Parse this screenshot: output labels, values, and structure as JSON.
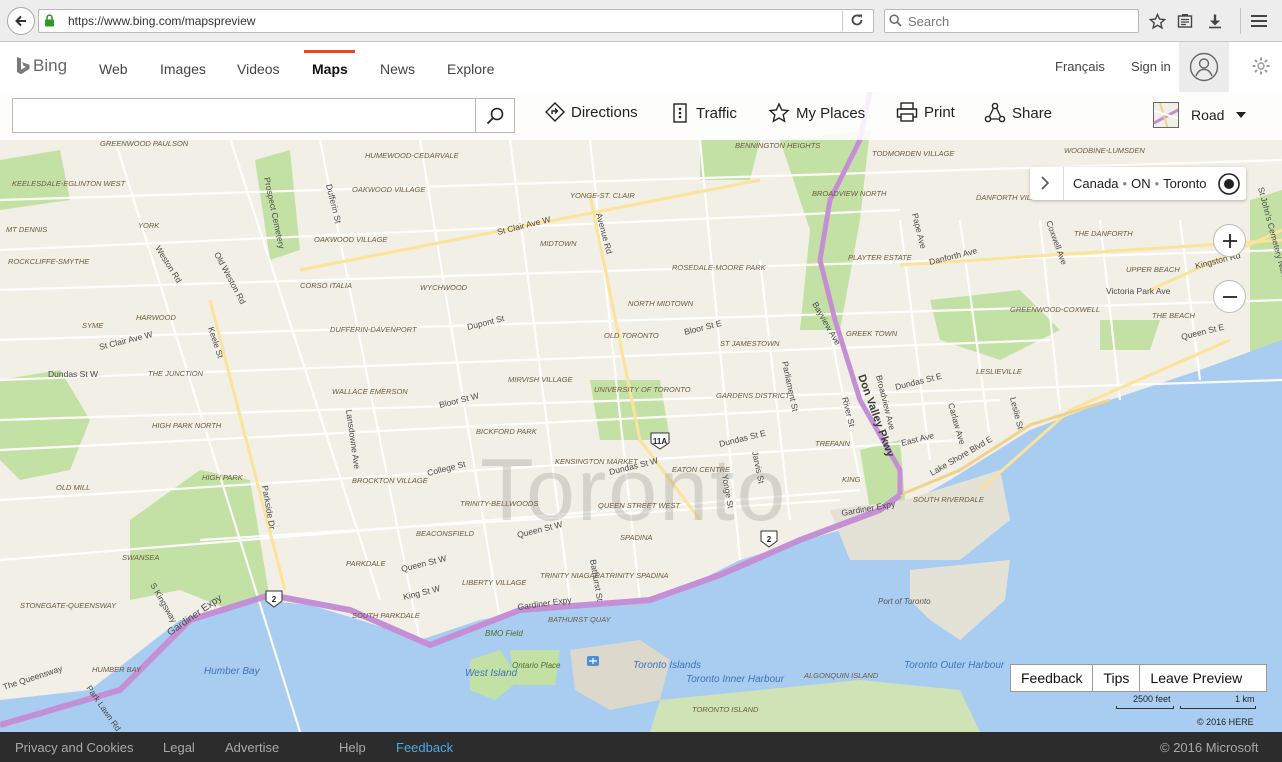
{
  "browser": {
    "url": "https://www.bing.com/mapspreview",
    "search_placeholder": "Search"
  },
  "header": {
    "brand": "Bing",
    "nav": [
      {
        "label": "Web"
      },
      {
        "label": "Images"
      },
      {
        "label": "Videos"
      },
      {
        "label": "Maps",
        "active": true
      },
      {
        "label": "News"
      },
      {
        "label": "Explore"
      }
    ],
    "language": "Français",
    "signin": "Sign in"
  },
  "toolbar": {
    "search_value": "",
    "directions": "Directions",
    "traffic": "Traffic",
    "my_places": "My Places",
    "print": "Print",
    "share": "Share",
    "map_style": "Road"
  },
  "location_bar": {
    "country": "Canada",
    "region": "ON",
    "city": "Toronto"
  },
  "map": {
    "city_watermark": "Toronto",
    "colors": {
      "land": "#f2efe6",
      "water": "#a8cdf0",
      "park": "#c4e1a5",
      "highway": "#c58fd6",
      "road": "#ffffff"
    },
    "neighbourhoods": [
      "GREENWOOD PAULSON",
      "HUMEWOOD-CEDARVALE",
      "BENNINGTON HEIGHTS",
      "TODMORDEN VILLAGE",
      "WOODBINE-LUMSDEN",
      "KEELESDALE-EGLINTON WEST",
      "OAKWOOD VILLAGE",
      "YONGE-ST. CLAIR",
      "BROADVIEW NORTH",
      "DANFORTH VILLAGE",
      "MT DENNIS",
      "YORK",
      "OAKWOOD VILLAGE",
      "MIDTOWN",
      "THE DANFORTH",
      "ROCKCLIFFE-SMYTHE",
      "PLAYTER ESTATE",
      "UPPER BEACH",
      "ROSEDALE-MOORE PARK",
      "CORSO ITALIA",
      "WYCHWOOD",
      "NORTH MIDTOWN",
      "HARWOOD",
      "GREENWOOD-COXWELL",
      "SYME",
      "DUFFERIN-DAVENPORT",
      "OLD TORONTO",
      "GREEK TOWN",
      "THE BEACH",
      "ST JAMESTOWN",
      "LESLIEVILLE",
      "THE JUNCTION",
      "MIRVISH VILLAGE",
      "UNIVERSITY OF TORONTO",
      "WALLACE EMERSON",
      "GARDENS DISTRICT",
      "HIGH PARK NORTH",
      "BICKFORD PARK",
      "TREFANN",
      "KENSINGTON MARKET",
      "EATON CENTRE",
      "OLD MILL",
      "HIGH PARK",
      "BROCKTON VILLAGE",
      "KING",
      "SOUTH RIVERDALE",
      "TRINITY-BELLWOODS",
      "QUEEN STREET WEST",
      "BEACONSFIELD",
      "SPADINA",
      "SWANSEA",
      "PARKDALE",
      "TRINITY NIAGARA",
      "TRINITY SPADINA",
      "LIBERTY VILLAGE",
      "STONEGATE-QUEENSWAY",
      "SOUTH PARKDALE",
      "BATHURST QUAY",
      "HUMBER BAY",
      "ALGONQUIN ISLAND",
      "TORONTO ISLAND"
    ],
    "streets": [
      "St Clair Ave W",
      "Avenue Rd",
      "Danforth Ave",
      "Kingston Rd",
      "Weston Rd",
      "Old Weston Rd",
      "Prospect Cemetery",
      "Dufferin St",
      "Dupont St",
      "Bloor St E",
      "Bayview Ave",
      "Pape Ave",
      "Coxwell Ave",
      "Victoria Park Ave",
      "St John's Cemetery Norway",
      "St Clair Ave W",
      "Keele St",
      "Dundas St W",
      "Bloor St W",
      "Parliament St",
      "Dundas St E",
      "Queen St E",
      "Don Valley Pkwy",
      "River St",
      "Broadview Ave",
      "Carlaw Ave",
      "Leslie St",
      "Lansdowne Ave",
      "Jarvis St",
      "Yonge St",
      "East Ave",
      "Lake Shore Blvd E",
      "College St",
      "Dundas St W",
      "Dundas St E",
      "Queen St W",
      "Gardiner Expy",
      "Parkside Dr",
      "Queen St W",
      "King St W",
      "Bathurst St",
      "Gardiner Expy",
      "S Kingsway",
      "The Queensway",
      "Park Lawn Rd"
    ],
    "water_labels": [
      "Humber Bay",
      "Toronto Inner Harbour",
      "Toronto Outer Harbour",
      "Toronto Islands",
      "West Island",
      "Ontario Place",
      "BMO Field",
      "Port of Toronto"
    ],
    "route_shields": [
      "11A",
      "2",
      "2"
    ]
  },
  "map_footer": {
    "feedback": "Feedback",
    "tips": "Tips",
    "leave_preview": "Leave Preview",
    "scale_imperial": "2500 feet",
    "scale_metric": "1 km",
    "copyright": "© 2016 HERE"
  },
  "footer": {
    "privacy": "Privacy and Cookies",
    "legal": "Legal",
    "advertise": "Advertise",
    "help": "Help",
    "feedback": "Feedback",
    "copyright": "© 2016 Microsoft"
  }
}
